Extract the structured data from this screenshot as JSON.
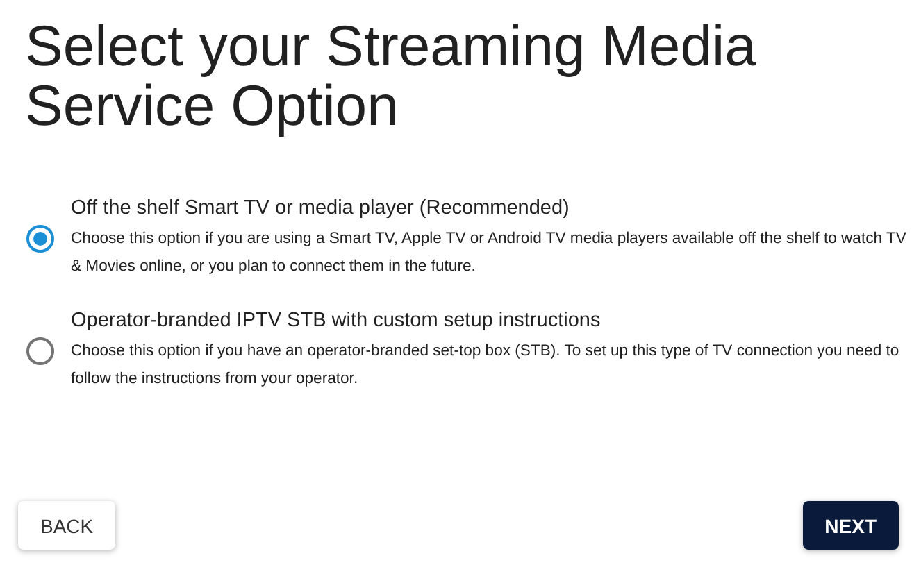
{
  "title": "Select your Streaming Media Service Option",
  "options": [
    {
      "label": "Off the shelf Smart TV or media player (Recommended)",
      "description": "Choose this option if you are using a Smart TV, Apple TV or Android TV media players available off the shelf to watch TV & Movies online, or you plan to connect them in the future.",
      "selected": true
    },
    {
      "label": "Operator-branded IPTV STB with custom setup instructions",
      "description": "Choose this option if you have an operator-branded set-top box (STB). To set up this type of TV connection you need to follow the instructions from your operator.",
      "selected": false
    }
  ],
  "buttons": [
    {
      "label": "BACK",
      "kind": "secondary"
    },
    {
      "label": "NEXT",
      "kind": "primary"
    }
  ]
}
